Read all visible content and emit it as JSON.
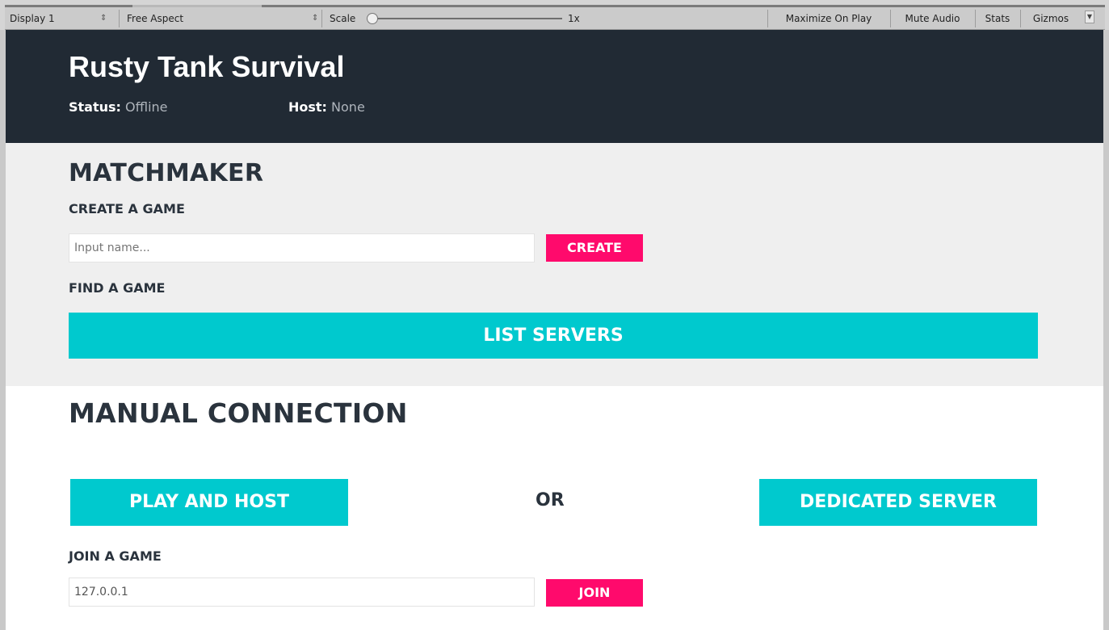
{
  "toolbar": {
    "display": "Display 1",
    "aspect": "Free Aspect",
    "scale_label": "Scale",
    "scale_value": "1x",
    "scale_level": 0,
    "maximize_on_play": "Maximize On Play",
    "mute_audio": "Mute Audio",
    "stats": "Stats",
    "gizmos": "Gizmos"
  },
  "header": {
    "title": "Rusty Tank Survival",
    "status_label": "Status:",
    "status_value": "Offline",
    "host_label": "Host:",
    "host_value": "None"
  },
  "matchmaker": {
    "heading": "MATCHMAKER",
    "create_heading": "CREATE A GAME",
    "name_placeholder": "Input name...",
    "create_button": "CREATE",
    "find_heading": "FIND A GAME",
    "list_servers_button": "LIST SERVERS"
  },
  "manual": {
    "heading": "MANUAL CONNECTION",
    "play_host_button": "PLAY AND HOST",
    "or_text": "OR",
    "dedicated_button": "DEDICATED SERVER",
    "join_heading": "JOIN A GAME",
    "ip_value": "127.0.0.1",
    "join_button": "JOIN"
  },
  "colors": {
    "header_bg": "#212a34",
    "panel_bg": "#efefef",
    "pink": "#ff0a6c",
    "teal": "#00c9ce"
  }
}
